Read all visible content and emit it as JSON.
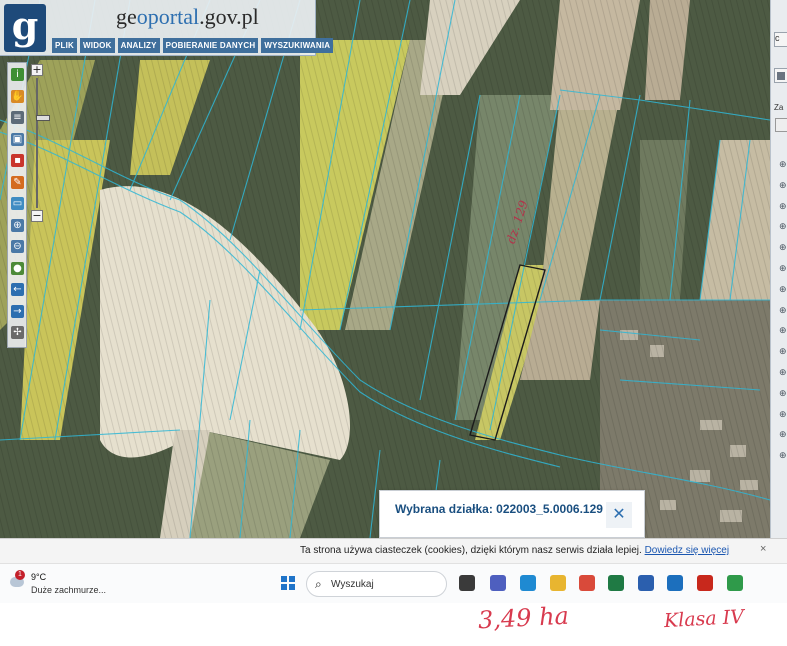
{
  "site": {
    "logo_letter": "g",
    "title_prefix": "ge",
    "title_accent": "oportal",
    "title_suffix": ".gov.pl"
  },
  "menu": {
    "items": [
      "PLIK",
      "WIDOK",
      "ANALIZY",
      "POBIERANIE DANYCH",
      "WYSZUKIWANIA"
    ]
  },
  "toolbar": {
    "tools": [
      {
        "icon": "info-icon",
        "glyph": "i",
        "color": "#3f8f34"
      },
      {
        "icon": "hand-pan-icon",
        "glyph": "✋",
        "color": "#d98a26"
      },
      {
        "icon": "document-icon",
        "glyph": "≡",
        "color": "#5d6b78"
      },
      {
        "icon": "monitor-icon",
        "glyph": "▣",
        "color": "#4b79a6"
      },
      {
        "icon": "select-region-icon",
        "glyph": "▪",
        "color": "#c9352c"
      },
      {
        "icon": "pencil-icon",
        "glyph": "✎",
        "color": "#d46b1f"
      },
      {
        "icon": "measure-icon",
        "glyph": "▭",
        "color": "#3f8cc2"
      },
      {
        "icon": "zoom-in-icon",
        "glyph": "⊕",
        "color": "#4b79a6"
      },
      {
        "icon": "zoom-out-icon",
        "glyph": "⊖",
        "color": "#4b79a6"
      },
      {
        "icon": "globe-icon",
        "glyph": "●",
        "color": "#4d8a38"
      },
      {
        "icon": "arrow-left-icon",
        "glyph": "←",
        "color": "#2d6fb0"
      },
      {
        "icon": "arrow-right-icon",
        "glyph": "→",
        "color": "#2d6fb0"
      },
      {
        "icon": "crosshair-icon",
        "glyph": "✢",
        "color": "#6a6a6a"
      }
    ]
  },
  "zoom": {
    "plus": "+",
    "minus": "−",
    "level": 0.3
  },
  "right_panel": {
    "top_button": "c",
    "section_label": "Za",
    "expand_glyph": "⊕"
  },
  "popup": {
    "label": "Wybrana działka: 022003_5.0006.129",
    "close": "✕"
  },
  "map_annotation": {
    "text": "dz. 129"
  },
  "cookie": {
    "text": "Ta strona używa ciasteczek (cookies), dzięki którym nasz serwis działa lepiej.",
    "link": "Dowiedz się więcej",
    "close": "×"
  },
  "taskbar": {
    "weather": {
      "temp": "9°C",
      "desc": "Duże zachmurze...",
      "badge": "1"
    },
    "search_placeholder": "Wyszukaj",
    "apps": [
      {
        "icon": "task-view-icon",
        "color": "#3a3a3a"
      },
      {
        "icon": "teams-icon",
        "color": "#4e5fbf"
      },
      {
        "icon": "edge-icon",
        "color": "#1f8ad2"
      },
      {
        "icon": "file-explorer-icon",
        "color": "#e8b530"
      },
      {
        "icon": "chrome-icon",
        "color": "#d94a3a"
      },
      {
        "icon": "excel-icon",
        "color": "#1f7a44"
      },
      {
        "icon": "word-icon",
        "color": "#2b5fae"
      },
      {
        "icon": "outlook-icon",
        "color": "#1c6fbd"
      },
      {
        "icon": "acrobat-icon",
        "color": "#c8281c"
      },
      {
        "icon": "green-app-icon",
        "color": "#2f9a4a"
      }
    ]
  },
  "handwriting": {
    "area": "3,49 ha",
    "note": "Klasa IV"
  }
}
